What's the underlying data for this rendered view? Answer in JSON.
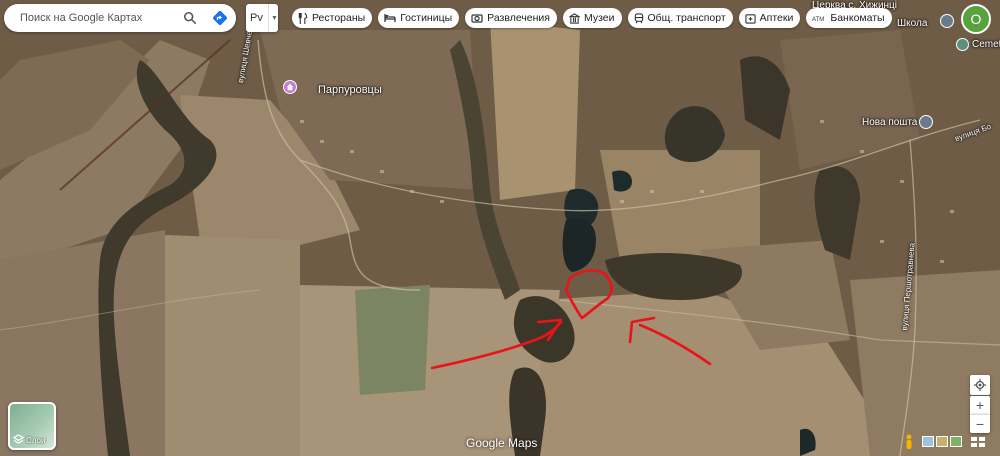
{
  "search": {
    "placeholder": "Поиск на Google Картах"
  },
  "region_selector": {
    "label": "Рv"
  },
  "categories": [
    {
      "label": "Рестораны",
      "icon": "restaurant-icon"
    },
    {
      "label": "Гостиницы",
      "icon": "hotel-icon"
    },
    {
      "label": "Развлечения",
      "icon": "camera-icon"
    },
    {
      "label": "Музеи",
      "icon": "museum-icon"
    },
    {
      "label": "Общ. транспорт",
      "icon": "transit-icon"
    },
    {
      "label": "Аптеки",
      "icon": "pharmacy-icon"
    },
    {
      "label": "Банкоматы",
      "icon": "atm-icon"
    }
  ],
  "map_labels": {
    "village": "Парпуровцы",
    "church": "Церква с. Хижинці",
    "school": "Школа",
    "cemetery": "Cemete",
    "post": "Нова пошта 1",
    "street_top": "вулиця Шевченка",
    "street_right": "вулиця Першотравнева",
    "street_east": "вулиця Бо"
  },
  "account": {
    "initial": "О"
  },
  "layers": {
    "label": "Слои"
  },
  "branding": "Google Maps",
  "zoom": {
    "in": "+",
    "out": "−"
  },
  "colors": {
    "annotation": "#e8141a",
    "pin": "#c77bd6",
    "account": "#57a340"
  }
}
